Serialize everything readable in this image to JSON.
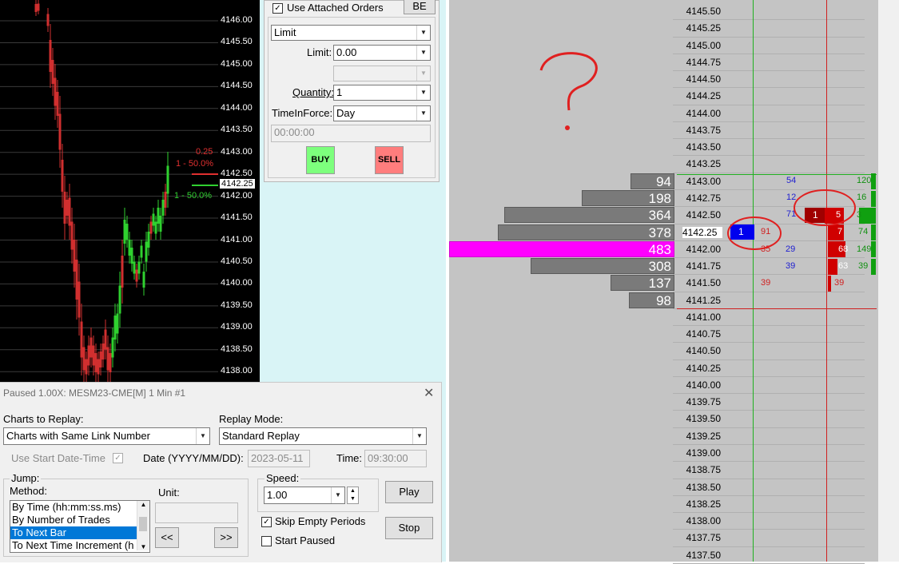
{
  "chart": {
    "price_ticks": [
      "4146.00",
      "4145.50",
      "4145.00",
      "4144.50",
      "4144.00",
      "4143.50",
      "4143.00",
      "4142.50",
      "4142.00",
      "4141.50",
      "4141.00",
      "4140.50",
      "4140.00",
      "4139.50",
      "4139.00",
      "4138.50",
      "4138.00"
    ],
    "current_price": "4142.25",
    "label_red_1": "0.25",
    "label_red_2": "1 - 50.0%",
    "label_green": "1 - 50.0%"
  },
  "order_panel": {
    "use_attached_orders": "Use Attached Orders",
    "be_button": "BE",
    "order_type": "Limit",
    "limit_label": "Limit:",
    "limit_value": "0.00",
    "quantity_label": "Quantity:",
    "quantity_value": "1",
    "tif_label": "TimeInForce:",
    "tif_value": "Day",
    "time_placeholder": "00:00:00",
    "buy_label": "BUY",
    "sell_label": "SELL"
  },
  "dom": {
    "prices": [
      "4145.50",
      "4145.25",
      "4145.00",
      "4144.75",
      "4144.50",
      "4144.25",
      "4144.00",
      "4143.75",
      "4143.50",
      "4143.25",
      "4143.00",
      "4142.75",
      "4142.50",
      "4142.25",
      "4142.00",
      "4141.75",
      "4141.50",
      "4141.25",
      "4141.00",
      "4140.75",
      "4140.50",
      "4140.25",
      "4140.00",
      "4139.75",
      "4139.50",
      "4139.25",
      "4139.00",
      "4138.75",
      "4138.50",
      "4138.25",
      "4138.00",
      "4137.75",
      "4137.50"
    ],
    "volume_profile": [
      94,
      198,
      364,
      378,
      483,
      308,
      137,
      98
    ],
    "bid_marker": "1",
    "ask_marker": "1",
    "numbers": {
      "n54": "54",
      "n12": "12",
      "n71": "71",
      "n29": "29",
      "n39a": "39",
      "n91": "91",
      "n35": "35",
      "n39b": "39",
      "n5": "5",
      "n7": "7",
      "n68": "68",
      "n63": "63",
      "n39c": "39",
      "n120": "120",
      "n16": "16",
      "n3": "3",
      "n74": "74",
      "n149": "149",
      "n39d": "39"
    },
    "annotation": "?"
  },
  "replay": {
    "title": "Paused 1.00X: MESM23-CME[M]  1 Min  #1",
    "charts_label": "Charts to Replay:",
    "charts_value": "Charts with Same Link Number",
    "mode_label": "Replay Mode:",
    "mode_value": "Standard Replay",
    "use_start_label": "Use Start Date-Time",
    "date_label": "Date (YYYY/MM/DD):",
    "date_value": "2023-05-11",
    "time_label": "Time:",
    "time_value": "09:30:00",
    "jump_label": "Jump:",
    "method_label": "Method:",
    "unit_label": "Unit:",
    "methods": [
      "By Time (hh:mm:ss.ms)",
      "By Number of Trades",
      "To Next Bar",
      "To Next Time Increment (h"
    ],
    "prev_button": "<<",
    "next_button": ">>",
    "speed_label": "Speed:",
    "speed_value": "1.00",
    "play_button": "Play",
    "stop_button": "Stop",
    "skip_label": "Skip Empty Periods",
    "start_paused_label": "Start Paused"
  }
}
